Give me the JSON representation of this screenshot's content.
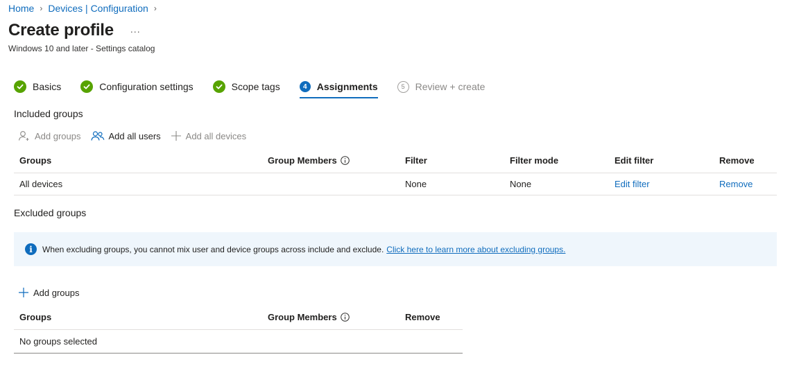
{
  "breadcrumb": {
    "home": "Home",
    "devices": "Devices | Configuration"
  },
  "header": {
    "title": "Create profile",
    "more": "...",
    "subtitle": "Windows 10 and later - Settings catalog"
  },
  "steps": [
    {
      "label": "Basics",
      "state": "done"
    },
    {
      "label": "Configuration settings",
      "state": "done"
    },
    {
      "label": "Scope tags",
      "state": "done"
    },
    {
      "label": "Assignments",
      "state": "current",
      "number": "4"
    },
    {
      "label": "Review + create",
      "state": "todo",
      "number": "5"
    }
  ],
  "included": {
    "title": "Included groups",
    "commands": {
      "add_groups": "Add groups",
      "add_all_users": "Add all users",
      "add_all_devices": "Add all devices"
    },
    "columns": {
      "groups": "Groups",
      "members": "Group Members",
      "filter": "Filter",
      "filter_mode": "Filter mode",
      "edit_filter": "Edit filter",
      "remove": "Remove"
    },
    "rows": [
      {
        "group": "All devices",
        "members": "",
        "filter": "None",
        "filter_mode": "None",
        "edit_filter": "Edit filter",
        "remove": "Remove"
      }
    ]
  },
  "excluded": {
    "title": "Excluded groups",
    "banner_text": "When excluding groups, you cannot mix user and device groups across include and exclude.",
    "banner_link": "Click here to learn more about excluding groups.",
    "commands": {
      "add_groups": "Add groups"
    },
    "columns": {
      "groups": "Groups",
      "members": "Group Members",
      "remove": "Remove"
    },
    "empty": "No groups selected"
  },
  "colors": {
    "accent": "#0f6cbd",
    "success": "#57a300",
    "banner_bg": "#eff6fc"
  }
}
